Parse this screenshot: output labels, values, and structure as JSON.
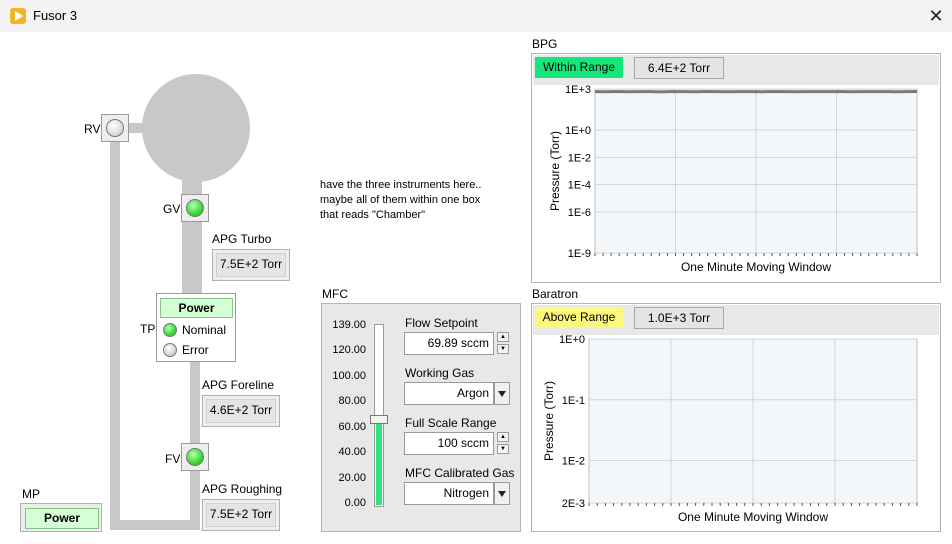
{
  "window": {
    "title": "Fusor 3",
    "close_glyph": "✕"
  },
  "schematic": {
    "rv_label": "RV",
    "gv_label": "GV",
    "fv_label": "FV",
    "tp_label": "TP",
    "mp_label": "MP",
    "apg_turbo": {
      "label": "APG Turbo",
      "value": "7.5E+2 Torr"
    },
    "apg_foreline": {
      "label": "APG Foreline",
      "value": "4.6E+2 Torr"
    },
    "apg_roughing": {
      "label": "APG Roughing",
      "value": "7.5E+2 Torr"
    },
    "tp_power_label": "Power",
    "tp_nominal_label": "Nominal",
    "tp_error_label": "Error",
    "mp_power_label": "Power"
  },
  "note": {
    "line1": "have the three instruments here..",
    "line2": "maybe all of them within one box",
    "line3": "that reads \"Chamber\""
  },
  "mfc": {
    "title": "MFC",
    "slider_value": 67,
    "slider_max": 139,
    "ticks": [
      "139.00",
      "120.00",
      "100.00",
      "80.00",
      "60.00",
      "40.00",
      "20.00",
      "0.00"
    ],
    "flow_setpoint_label": "Flow Setpoint",
    "flow_setpoint_value": "69.89 sccm",
    "working_gas_label": "Working Gas",
    "working_gas_value": "Argon",
    "full_scale_label": "Full Scale Range",
    "full_scale_value": "100 sccm",
    "calibrated_gas_label": "MFC Calibrated Gas",
    "calibrated_gas_value": "Nitrogen"
  },
  "bpg": {
    "title": "BPG",
    "status": "Within Range",
    "status_color": "#14e67c",
    "reading": "6.4E+2 Torr"
  },
  "baratron": {
    "title": "Baratron",
    "status": "Above Range",
    "status_color": "#fbf97c",
    "reading": "1.0E+3 Torr"
  },
  "chart_data": [
    {
      "type": "line",
      "title": "",
      "xlabel": "One Minute Moving Window",
      "ylabel": "Pressure (Torr)",
      "y_scale": "log",
      "ylim": [
        1e-09,
        1000
      ],
      "yticks": [
        "1E+3",
        "1E+0",
        "1E-2",
        "1E-4",
        "1E-6",
        "1E-9"
      ],
      "grid": true,
      "series": [
        {
          "values": [
            640,
            620,
            660,
            630,
            650,
            640,
            615,
            655,
            640,
            630,
            660,
            645,
            625,
            650,
            640,
            635,
            655,
            640,
            630,
            650,
            645,
            640,
            660,
            630,
            645,
            640,
            650,
            635,
            640,
            655
          ]
        }
      ]
    },
    {
      "type": "line",
      "title": "",
      "xlabel": "One Minute Moving Window",
      "ylabel": "Pressure (Torr)",
      "y_scale": "log",
      "ylim": [
        0.002,
        1
      ],
      "yticks": [
        "1E+0",
        "1E-1",
        "1E-2",
        "2E-3"
      ],
      "grid": true,
      "series": []
    }
  ]
}
